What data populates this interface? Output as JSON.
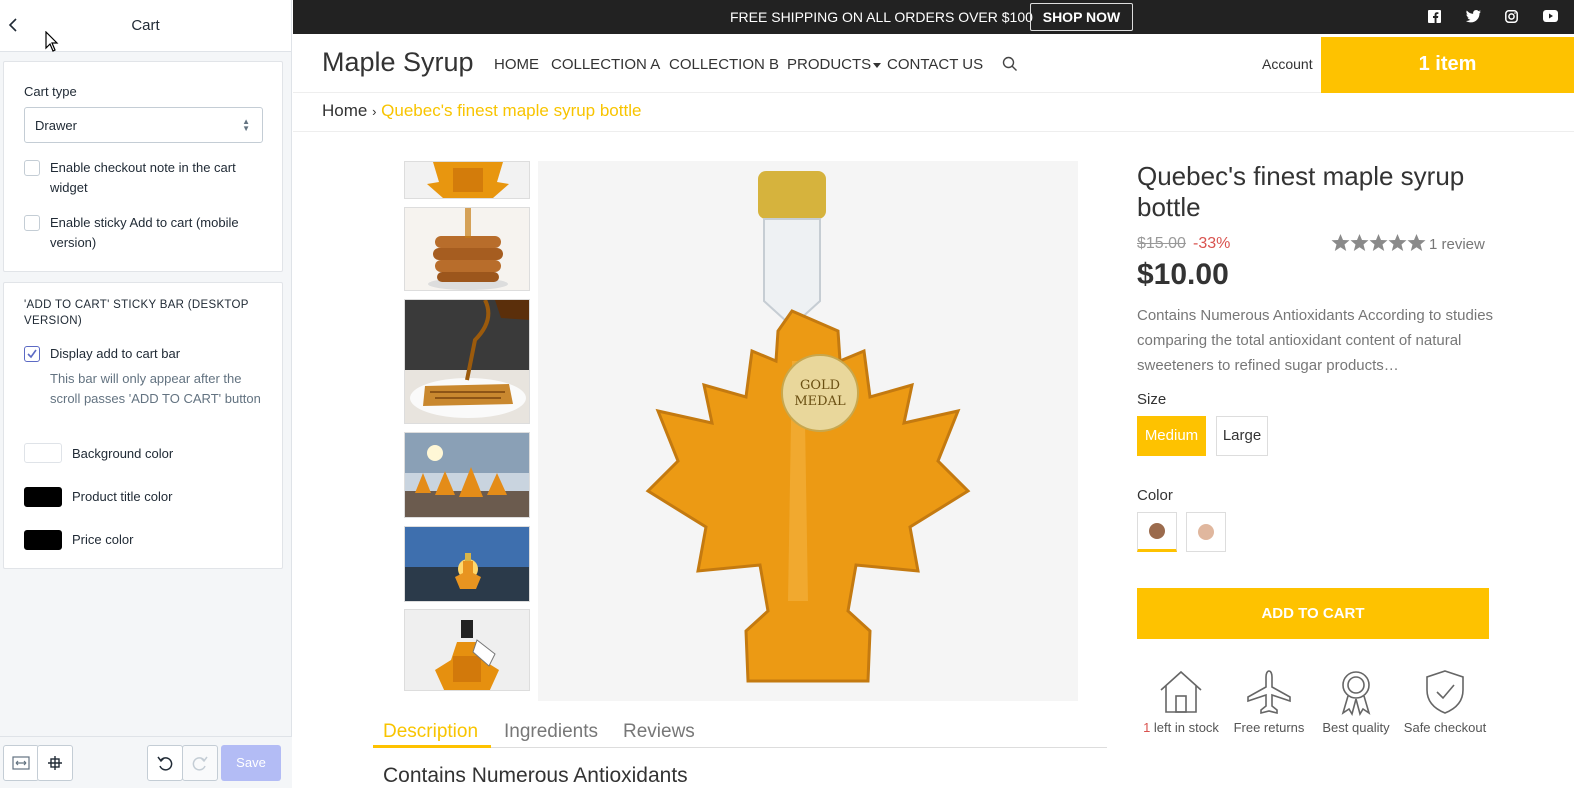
{
  "editor": {
    "title": "Cart",
    "cart_type": {
      "label": "Cart type",
      "value": "Drawer"
    },
    "checkboxes": [
      {
        "label": "Enable checkout note in the cart widget",
        "checked": false
      },
      {
        "label": "Enable sticky Add to cart (mobile version)",
        "checked": false
      }
    ],
    "sticky_section": {
      "heading": "'ADD TO CART' STICKY BAR (DESKTOP VERSION)",
      "display_label": "Display add to cart bar",
      "display_checked": true,
      "help": "This bar will only appear after the scroll passes 'ADD TO CART' button",
      "colors": [
        {
          "label": "Background color",
          "value": "#ffffff"
        },
        {
          "label": "Product title color",
          "value": "#000000"
        },
        {
          "label": "Price color",
          "value": "#000000"
        }
      ]
    },
    "save_label": "Save"
  },
  "store": {
    "announcement": "FREE SHIPPING ON ALL ORDERS OVER $100",
    "shop_now": "SHOP NOW",
    "logo": "Maple Syrup",
    "nav": [
      "HOME",
      "COLLECTION A",
      "COLLECTION B",
      "PRODUCTS",
      "CONTACT US"
    ],
    "account": "Account",
    "cart": "1 item",
    "breadcrumb": {
      "home": "Home",
      "sep": "›",
      "current": "Quebec's finest maple syrup bottle"
    },
    "tabs": [
      "Description",
      "Ingredients",
      "Reviews"
    ],
    "description_heading": "Contains Numerous Antioxidants",
    "product": {
      "title": "Quebec's finest maple syrup bottle",
      "compare_price": "$15.00",
      "discount": "-33%",
      "rating": 5,
      "reviews": "1 review",
      "price": "$10.00",
      "excerpt": "Contains Numerous Antioxidants According to studies comparing the total antioxidant content of natural sweeteners to refined sugar products…",
      "size_label": "Size",
      "sizes": [
        "Medium",
        "Large"
      ],
      "selected_size": "Medium",
      "color_label": "Color",
      "colors": [
        "#9b6b4d",
        "#e0b79e"
      ],
      "add_to_cart": "ADD TO CART",
      "features": [
        {
          "count": "1",
          "label": " left in stock"
        },
        {
          "label": "Free returns"
        },
        {
          "label": "Best quality"
        },
        {
          "label": "Safe checkout"
        }
      ]
    },
    "colors": {
      "accent": "#fec200",
      "sale": "#d9534f",
      "bar": "#222222"
    }
  }
}
